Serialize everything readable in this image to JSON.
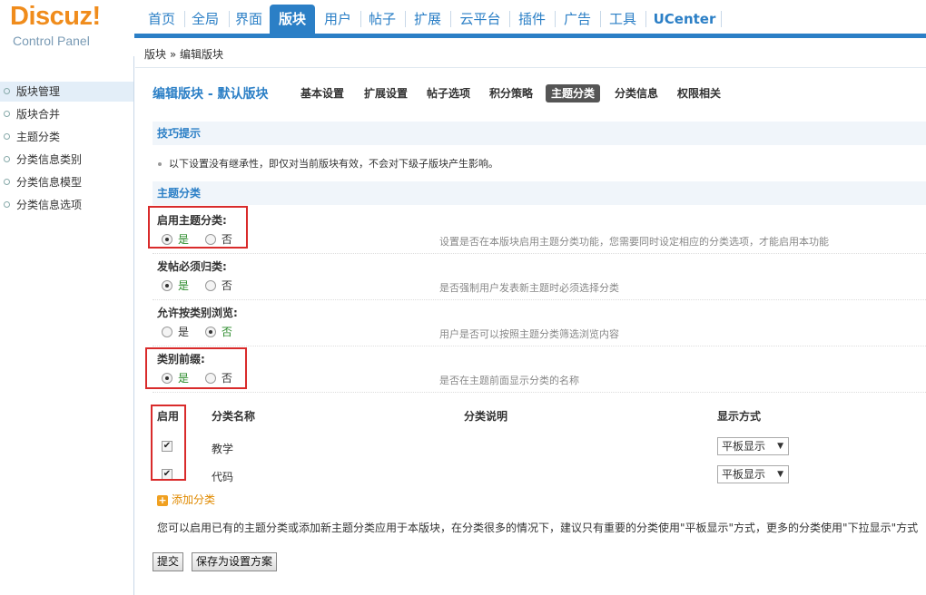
{
  "logo": {
    "brand": "Discuz!",
    "sub": "Control Panel"
  },
  "topnav": [
    "首页",
    "全局",
    "界面",
    "版块",
    "用户",
    "帖子",
    "扩展",
    "云平台",
    "插件",
    "广告",
    "工具",
    "UCenter"
  ],
  "sidebar": [
    "版块管理",
    "版块合并",
    "主题分类",
    "分类信息类别",
    "分类信息模型",
    "分类信息选项"
  ],
  "breadcrumb": "版块 » 编辑版块",
  "page_title": "编辑版块 - 默认版块",
  "subtabs": [
    "基本设置",
    "扩展设置",
    "帖子选项",
    "积分策略",
    "主题分类",
    "分类信息",
    "权限相关"
  ],
  "tips": {
    "title": "技巧提示",
    "text": "以下设置没有继承性，即仅对当前版块有效，不会对下级子版块产生影响。"
  },
  "section_title": "主题分类",
  "yes_label": "是",
  "no_label": "否",
  "settings": [
    {
      "label": "启用主题分类:",
      "value": "是",
      "desc": "设置是否在本版块启用主题分类功能，您需要同时设定相应的分类选项，才能启用本功能"
    },
    {
      "label": "发帖必须归类:",
      "value": "是",
      "desc": "是否强制用户发表新主题时必须选择分类"
    },
    {
      "label": "允许按类别浏览:",
      "value": "否",
      "desc": "用户是否可以按照主题分类筛选浏览内容"
    },
    {
      "label": "类别前缀:",
      "value": "是",
      "desc": "是否在主题前面显示分类的名称"
    }
  ],
  "table": {
    "headers": [
      "启用",
      "分类名称",
      "分类说明",
      "显示方式"
    ],
    "rows": [
      {
        "enabled": true,
        "name": "教学",
        "desc": "",
        "display": "平板显示"
      },
      {
        "enabled": true,
        "name": "代码",
        "desc": "",
        "display": "平板显示"
      }
    ]
  },
  "add_category": "添加分类",
  "note": "您可以启用已有的主题分类或添加新主题分类应用于本版块，在分类很多的情况下，建议只有重要的分类使用\"平板显示\"方式，更多的分类使用\"下拉显示\"方式",
  "buttons": {
    "submit": "提交",
    "save_scheme": "保存为设置方案"
  },
  "colors": {
    "accent": "#2b7fc6",
    "highlight_box": "#d92b2b",
    "logo": "#f08c1c"
  }
}
